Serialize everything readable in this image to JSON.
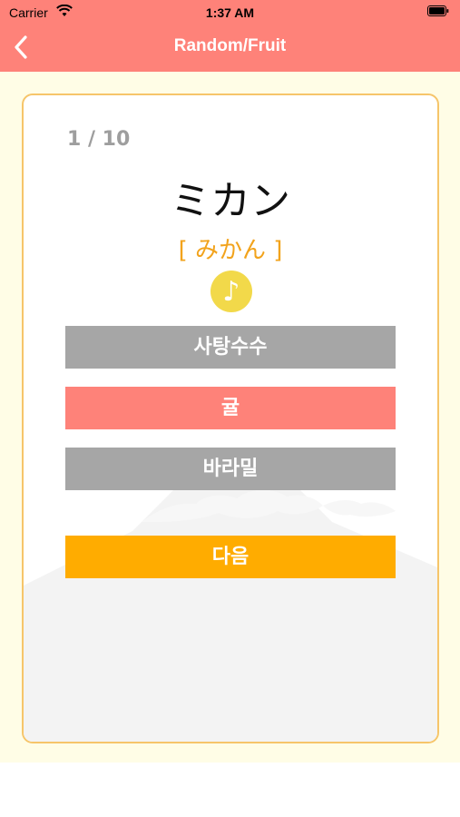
{
  "status_bar": {
    "carrier": "Carrier",
    "time": "1:37 AM"
  },
  "nav": {
    "title": "Random/Fruit",
    "back_icon": "chevron-left-icon"
  },
  "quiz": {
    "progress": "1 / 10",
    "word": "ミカン",
    "reading": "[ みかん ]",
    "sound_icon": "music-note-icon",
    "choices": [
      {
        "label": "사탕수수",
        "state": "default"
      },
      {
        "label": "귤",
        "state": "correct"
      },
      {
        "label": "바라밀",
        "state": "default"
      }
    ],
    "next_label": "다음"
  },
  "colors": {
    "header": "#fe8279",
    "background": "#fffde6",
    "card_border": "#f6c56a",
    "choice_default": "#a6a6a6",
    "choice_correct": "#fe8279",
    "next_button": "#ffac00",
    "reading_text": "#f2a31c",
    "sound_button": "#f2d94a"
  }
}
